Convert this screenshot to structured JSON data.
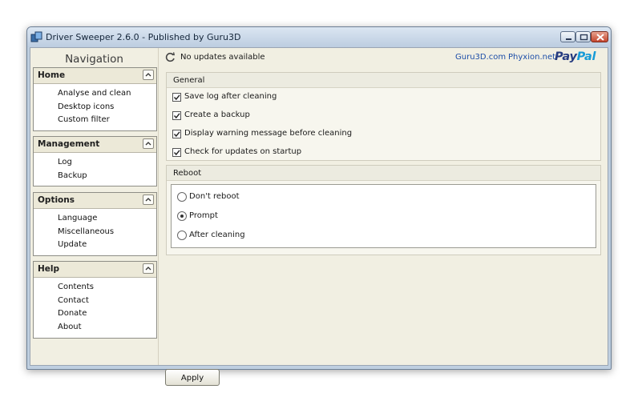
{
  "window": {
    "title": "Driver Sweeper 2.6.0 - Published by Guru3D"
  },
  "nav": {
    "title": "Navigation",
    "groups": [
      {
        "label": "Home",
        "items": [
          "Analyse and clean",
          "Desktop icons",
          "Custom filter"
        ]
      },
      {
        "label": "Management",
        "items": [
          "Log",
          "Backup"
        ]
      },
      {
        "label": "Options",
        "items": [
          "Language",
          "Miscellaneous",
          "Update"
        ]
      },
      {
        "label": "Help",
        "items": [
          "Contents",
          "Contact",
          "Donate",
          "About"
        ]
      }
    ]
  },
  "topbar": {
    "status": "No updates available",
    "links": [
      "Guru3D.com",
      "Phyxion.net"
    ],
    "paypal": {
      "part1": "Pay",
      "part2": "Pal"
    }
  },
  "general": {
    "title": "General",
    "options": [
      {
        "label": "Save log after cleaning",
        "checked": true
      },
      {
        "label": "Create a backup",
        "checked": true
      },
      {
        "label": "Display warning message before cleaning",
        "checked": true
      },
      {
        "label": "Check for updates on startup",
        "checked": true
      }
    ]
  },
  "reboot": {
    "title": "Reboot",
    "options": [
      {
        "label": "Don't reboot",
        "selected": false
      },
      {
        "label": "Prompt",
        "selected": true
      },
      {
        "label": "After cleaning",
        "selected": false
      }
    ]
  },
  "apply_label": "Apply"
}
